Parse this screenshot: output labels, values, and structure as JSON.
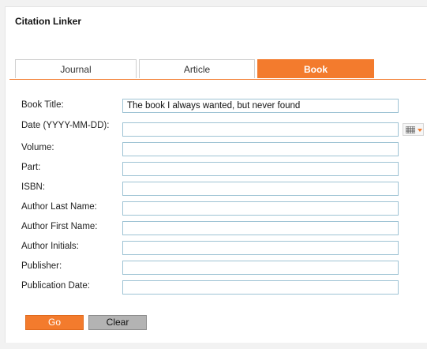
{
  "panel": {
    "title": "Citation Linker"
  },
  "tabs": [
    {
      "label": "Journal",
      "active": false
    },
    {
      "label": "Article",
      "active": false
    },
    {
      "label": "Book",
      "active": true
    }
  ],
  "form": {
    "fields": [
      {
        "label": "Book Title:",
        "value": "The book I always wanted, but never found"
      },
      {
        "label": "Date (YYYY-MM-DD):",
        "value": ""
      },
      {
        "label": "Volume:",
        "value": ""
      },
      {
        "label": "Part:",
        "value": ""
      },
      {
        "label": "ISBN:",
        "value": ""
      },
      {
        "label": "Author Last Name:",
        "value": ""
      },
      {
        "label": "Author First Name:",
        "value": ""
      },
      {
        "label": "Author Initials:",
        "value": ""
      },
      {
        "label": "Publisher:",
        "value": ""
      },
      {
        "label": "Publication Date:",
        "value": ""
      }
    ]
  },
  "buttons": {
    "go_label": "Go",
    "clear_label": "Clear"
  },
  "icons": {
    "calendar": "calendar-grid-icon",
    "dropdown": "chevron-down-icon"
  },
  "colors": {
    "accent": "#f37b2d",
    "input_border": "#9ec3d4",
    "clear_button": "#b3b3b3"
  }
}
